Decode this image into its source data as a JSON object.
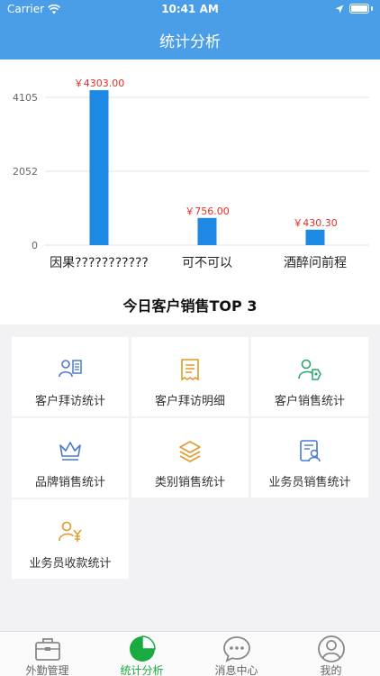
{
  "status_bar": {
    "carrier": "Carrier",
    "time": "10:41 AM"
  },
  "nav": {
    "title": "统计分析"
  },
  "chart_data": {
    "type": "bar",
    "categories": [
      "因果???????????",
      "可不可以",
      "酒醉问前程"
    ],
    "values": [
      4303.0,
      756.0,
      430.3
    ],
    "value_labels": [
      "￥4303.00",
      "￥756.00",
      "￥430.30"
    ],
    "y_ticks": [
      "4105",
      "2052",
      "0"
    ],
    "ylim": [
      0,
      4105
    ],
    "bar_color": "#1e88e5",
    "value_label_color": "#e5302a",
    "grid": true
  },
  "top_title": "今日客户销售TOP 3",
  "menu": [
    {
      "label": "客户拜访统计",
      "icon": "customer-visit-stats-icon",
      "color": "#4a7bd0"
    },
    {
      "label": "客户拜访明细",
      "icon": "visit-detail-receipt-icon",
      "color": "#e09a2a"
    },
    {
      "label": "客户销售统计",
      "icon": "customer-sales-stats-icon",
      "color": "#2aa86a"
    },
    {
      "label": "品牌销售统计",
      "icon": "brand-crown-icon",
      "color": "#4a7bd0"
    },
    {
      "label": "类别销售统计",
      "icon": "category-layers-icon",
      "color": "#e09a2a"
    },
    {
      "label": "业务员销售统计",
      "icon": "salesman-card-icon",
      "color": "#4a7bd0"
    },
    {
      "label": "业务员收款统计",
      "icon": "salesman-collection-icon",
      "color": "#e09a2a"
    }
  ],
  "tabs": [
    {
      "label": "外勤管理",
      "icon": "briefcase-icon",
      "active": false
    },
    {
      "label": "统计分析",
      "icon": "pie-chart-icon",
      "active": true
    },
    {
      "label": "消息中心",
      "icon": "chat-bubble-icon",
      "active": false
    },
    {
      "label": "我的",
      "icon": "user-profile-icon",
      "active": false
    }
  ]
}
